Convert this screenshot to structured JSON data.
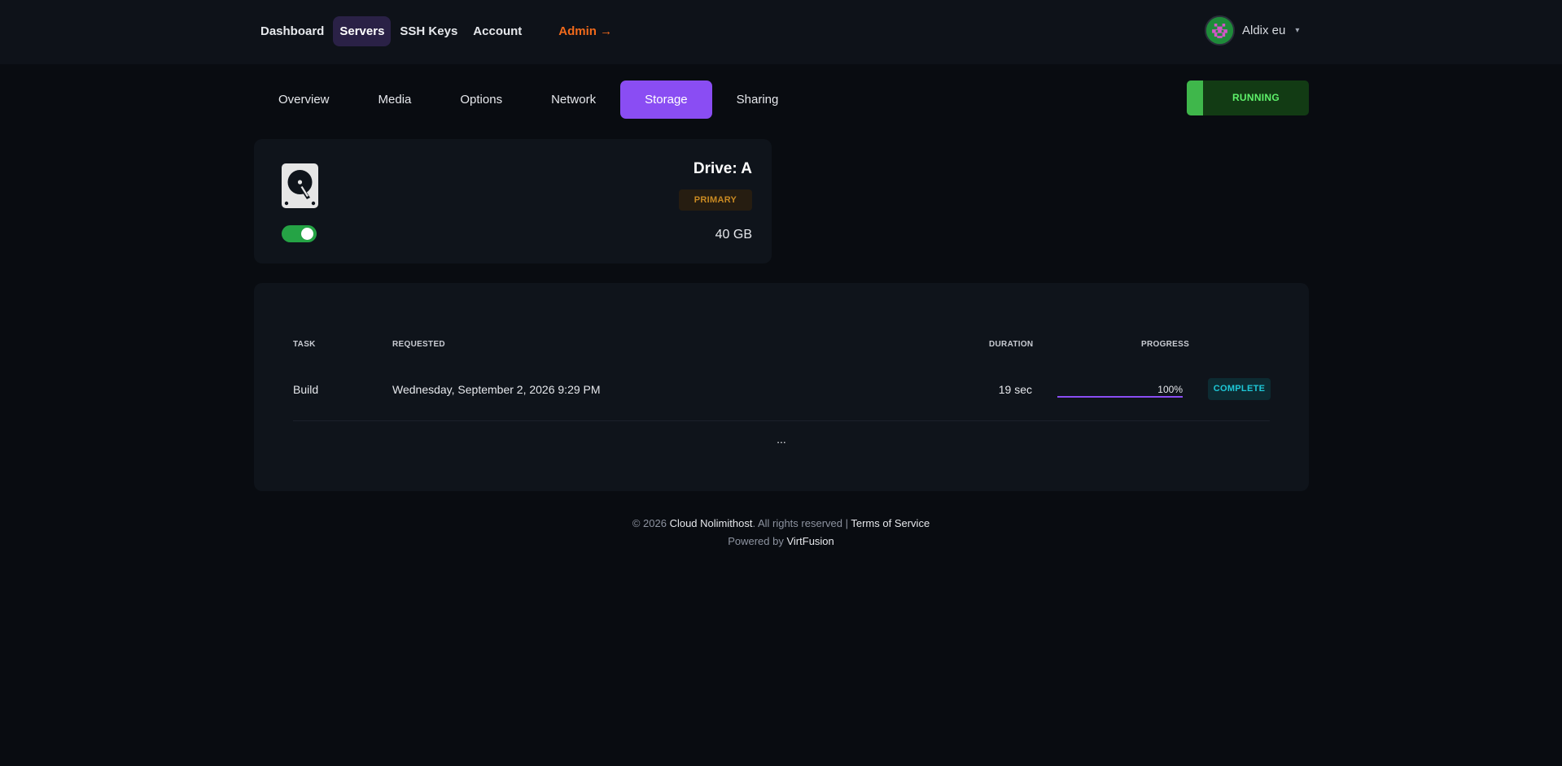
{
  "nav": {
    "items": [
      {
        "label": "Dashboard"
      },
      {
        "label": "Servers"
      },
      {
        "label": "SSH Keys"
      },
      {
        "label": "Account"
      }
    ],
    "admin_label": "Admin →"
  },
  "user": {
    "name": "Aldix eu",
    "caret": "▾"
  },
  "tabs": [
    {
      "label": "Overview"
    },
    {
      "label": "Media"
    },
    {
      "label": "Options"
    },
    {
      "label": "Network"
    },
    {
      "label": "Storage"
    },
    {
      "label": "Sharing"
    }
  ],
  "active_tab": "Storage",
  "status": {
    "label": "RUNNING",
    "color": "#5ef06a"
  },
  "drive": {
    "title": "Drive: A",
    "badge": "PRIMARY",
    "size": "40 GB",
    "enabled": true,
    "icon": "hard-drive-icon"
  },
  "tasks": {
    "headers": {
      "task": "TASK",
      "requested": "REQUESTED",
      "duration": "DURATION",
      "progress": "PROGRESS"
    },
    "rows": [
      {
        "task": "Build",
        "requested": "Wednesday, September 2, 2026 9:29 PM",
        "duration": "19 sec",
        "progress_label": "100%",
        "progress": 100,
        "status": "COMPLETE"
      }
    ],
    "more_label": "..."
  },
  "footer": {
    "copyright": "© 2026",
    "company": "Cloud Nolimithost",
    "rights": ". All rights reserved |",
    "terms": "Terms of Service",
    "powered_by": "Powered by",
    "powered_name": "VirtFusion"
  },
  "colors": {
    "accent": "#8a4df3",
    "admin": "#f26a1b",
    "running": "#3fb74b",
    "primary_badge": "#c98a22",
    "complete_badge": "#1ec7d6"
  }
}
